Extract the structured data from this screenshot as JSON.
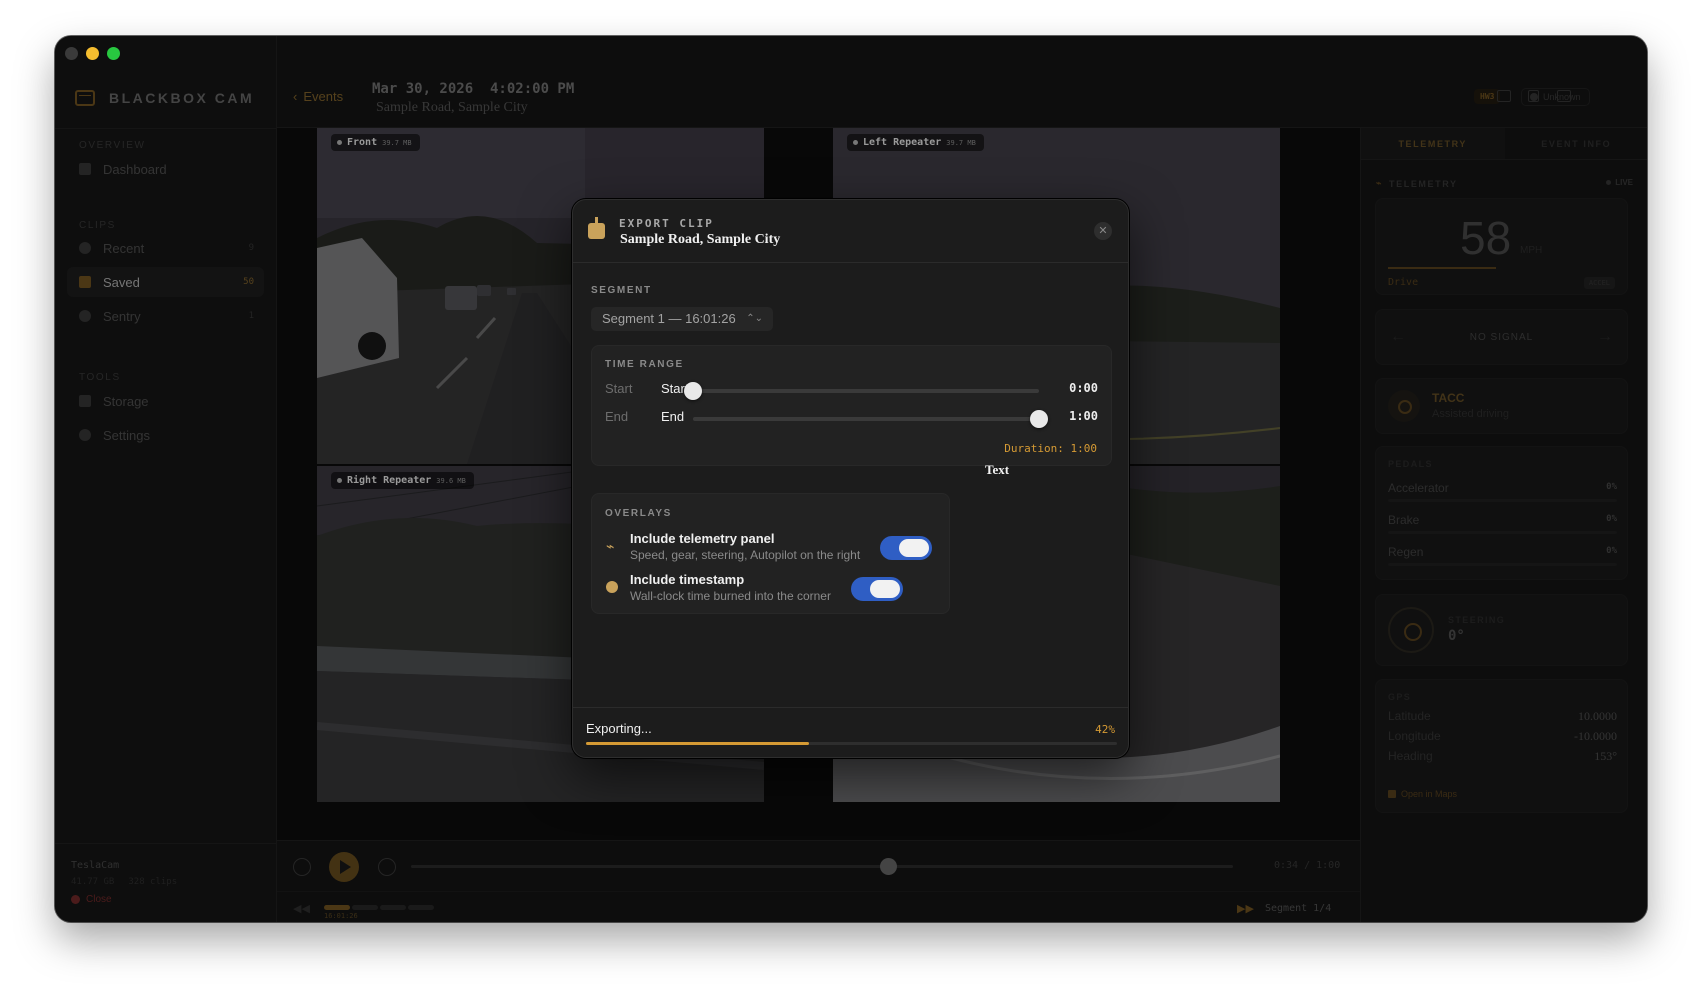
{
  "window": {
    "traffic_lights": [
      "close",
      "minimize",
      "maximize"
    ]
  },
  "sidebar": {
    "brand": "BLACKBOX CAM",
    "sections": {
      "overview": "OVERVIEW",
      "clips": "CLIPS",
      "tools": "TOOLS"
    },
    "items": [
      {
        "label": "Dashboard",
        "count": ""
      },
      {
        "label": "Recent",
        "count": "9"
      },
      {
        "label": "Saved",
        "count": "50"
      },
      {
        "label": "Sentry",
        "count": "1"
      },
      {
        "label": "Storage",
        "count": ""
      },
      {
        "label": "Settings",
        "count": ""
      }
    ],
    "footer": {
      "name": "TeslaCam",
      "size": "41.77 GB",
      "clips": "328 clips",
      "close": "Close"
    }
  },
  "header": {
    "back": "Events",
    "date": "Mar 30, 2026  4:02:00 PM",
    "place": "Sample Road, Sample City",
    "hw_badge": "HW3",
    "unknown_badge": "Unknown"
  },
  "cameras": [
    {
      "name": "Front",
      "size": "39.7 MB"
    },
    {
      "name": "Left Repeater",
      "size": "39.7 MB"
    },
    {
      "name": "Right Repeater",
      "size": "39.6 MB"
    }
  ],
  "transport": {
    "time": "0:34 / 1:00",
    "progress": 0.58,
    "segment_time": "16:01:26",
    "segment_info": "Segment 1/4"
  },
  "right_panel": {
    "tabs": [
      "TELEMETRY",
      "EVENT INFO"
    ],
    "heading": "TELEMETRY",
    "live": "LIVE",
    "speed": "58",
    "speed_unit": "MPH",
    "gear": "Drive",
    "accel": "ACCEL",
    "no_signal": "NO SIGNAL",
    "tacc_title": "TACC",
    "tacc_sub": "Assisted driving",
    "pedals_label": "PEDALS",
    "pedals": [
      {
        "name": "Accelerator",
        "value": "0%"
      },
      {
        "name": "Brake",
        "value": "0%"
      },
      {
        "name": "Regen",
        "value": "0%"
      }
    ],
    "steering_label": "STEERING",
    "steering_value": "0°",
    "gps_label": "GPS",
    "gps": [
      {
        "name": "Latitude",
        "value": "10.0000"
      },
      {
        "name": "Longitude",
        "value": "-10.0000"
      },
      {
        "name": "Heading",
        "value": "153°"
      }
    ],
    "open_maps": "Open in Maps"
  },
  "modal": {
    "kicker": "EXPORT CLIP",
    "title": "Sample Road, Sample City",
    "segment_label": "SEGMENT",
    "segment_value": "Segment 1 — 16:01:26",
    "time_range_label": "TIME RANGE",
    "start_muted": "Start",
    "start_name": "Start",
    "start_value": "0:00",
    "start_position": 0.0,
    "end_muted": "End",
    "end_name": "End",
    "end_value": "1:00",
    "end_position": 1.0,
    "duration": "Duration: 1:00",
    "stray_text": "Text",
    "overlays_label": "OVERLAYS",
    "overlays": [
      {
        "title": "Include telemetry panel",
        "sub": "Speed, gear, steering, Autopilot on the right",
        "on": true
      },
      {
        "title": "Include timestamp",
        "sub": "Wall-clock time burned into the corner",
        "on": true
      }
    ],
    "exporting": "Exporting...",
    "export_pct": "42%",
    "export_progress": 0.42
  },
  "colors": {
    "accent": "#d59a34",
    "toggle_on": "#2f5ec4",
    "background": "#151515"
  }
}
